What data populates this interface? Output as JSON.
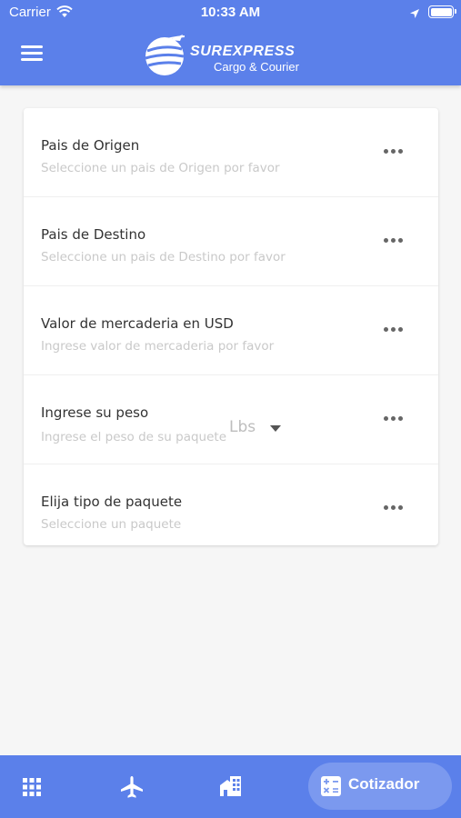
{
  "status_bar": {
    "carrier": "Carrier",
    "time": "10:33 AM"
  },
  "header": {
    "brand_name": "SUREXPRESS",
    "brand_tagline": "Cargo & Courier",
    "menu_icon": "hamburger-menu-icon",
    "color": "#5b80ea"
  },
  "form": {
    "rows": [
      {
        "label": "Pais de Origen",
        "hint": "Seleccione un pais de Origen por favor"
      },
      {
        "label": "Pais de Destino",
        "hint": "Seleccione un pais de Destino por favor"
      },
      {
        "label": "Valor de mercaderia en USD",
        "hint": "Ingrese valor de mercaderia por favor"
      },
      {
        "label": "Ingrese su peso",
        "hint": "Ingrese el peso de su paquete",
        "unit": "Lbs"
      },
      {
        "label": "Elija tipo de paquete",
        "hint": "Seleccione un paquete"
      }
    ],
    "more_icon": "more-horizontal-icon"
  },
  "bottom_nav": {
    "items": [
      {
        "icon": "grid-icon"
      },
      {
        "icon": "airplane-icon"
      },
      {
        "icon": "buildings-icon"
      },
      {
        "icon": "calculator-icon",
        "label": "Cotizador",
        "active": true
      }
    ],
    "accent": "#7b99ef"
  }
}
